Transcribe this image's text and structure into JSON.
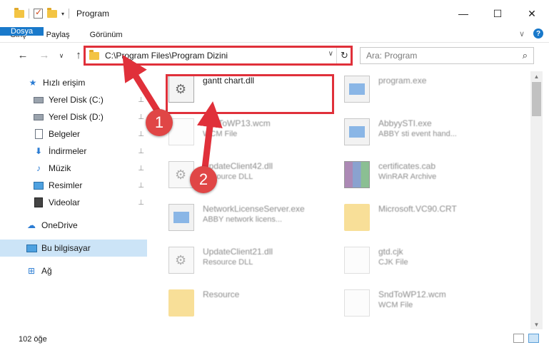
{
  "window": {
    "title": "Program",
    "minimize_glyph": "—",
    "maximize_glyph": "☐",
    "close_glyph": "✕"
  },
  "ribbon": {
    "tabs": [
      "Dosya",
      "Giriş",
      "Paylaş",
      "Görünüm"
    ],
    "expand_glyph": "∨",
    "help_glyph": "?"
  },
  "nav": {
    "back": "←",
    "forward": "→",
    "recent": "∨",
    "up": "↑",
    "address": "C:\\Program Files\\Program Dizini",
    "address_dropdown": "∨",
    "refresh": "↻",
    "search_placeholder": "Ara: Program",
    "search_icon": "⌕"
  },
  "sidebar": {
    "items": [
      {
        "label": "Hızlı erişim",
        "icon": "star-icon"
      },
      {
        "label": "Yerel Disk (C:)",
        "icon": "drive-icon",
        "pinned": true
      },
      {
        "label": "Yerel Disk (D:)",
        "icon": "drive-icon",
        "pinned": true
      },
      {
        "label": "Belgeler",
        "icon": "documents-icon",
        "pinned": true
      },
      {
        "label": "İndirmeler",
        "icon": "downloads-icon",
        "pinned": true
      },
      {
        "label": "Müzik",
        "icon": "music-icon",
        "pinned": true
      },
      {
        "label": "Resimler",
        "icon": "pictures-icon",
        "pinned": true
      },
      {
        "label": "Videolar",
        "icon": "videos-icon",
        "pinned": true
      },
      {
        "label": "OneDrive",
        "icon": "onedrive-icon"
      },
      {
        "label": "Bu bilgisayar",
        "icon": "computer-icon",
        "selected": true
      },
      {
        "label": "Ağ",
        "icon": "network-icon"
      }
    ],
    "pin_glyph": "📌"
  },
  "files": [
    {
      "name": "gantt chart.dll",
      "desc": "",
      "type": "dll"
    },
    {
      "name": "program.exe",
      "desc": "",
      "type": "app"
    },
    {
      "name": "SndToWP13.wcm",
      "desc": "WCM File",
      "type": "blank"
    },
    {
      "name": "AbbyySTI.exe",
      "desc": "ABBY sti event hand...",
      "type": "app"
    },
    {
      "name": "UpdateClient42.dll",
      "desc": "Resource DLL",
      "type": "dll"
    },
    {
      "name": "certificates.cab",
      "desc": "WinRAR Archive",
      "type": "cab"
    },
    {
      "name": "NetworkLicenseServer.exe",
      "desc": "ABBY network licens...",
      "type": "app"
    },
    {
      "name": "Microsoft.VC90.CRT",
      "desc": "",
      "type": "fold"
    },
    {
      "name": "UpdateClient21.dll",
      "desc": "Resource DLL",
      "type": "dll"
    },
    {
      "name": "gtd.cjk",
      "desc": "CJK File",
      "type": "blank"
    },
    {
      "name": "Resource",
      "desc": "",
      "type": "fold"
    },
    {
      "name": "SndToWP12.wcm",
      "desc": "WCM File",
      "type": "blank"
    }
  ],
  "status": {
    "count": "102 öğe"
  },
  "annotations": {
    "step1": "1",
    "step2": "2",
    "color": "#e0303a"
  }
}
